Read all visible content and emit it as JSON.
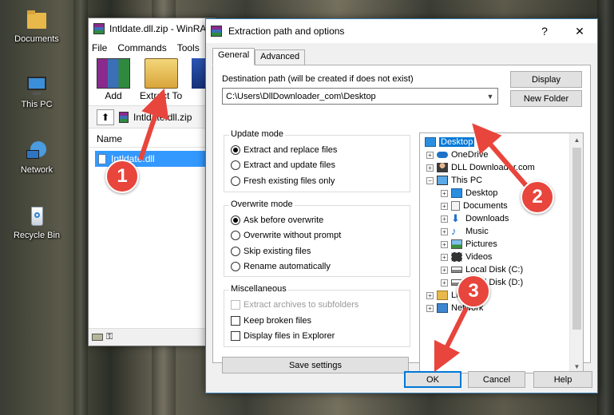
{
  "desktop": {
    "icons": [
      {
        "label": "Documents",
        "icon": "folder-icon"
      },
      {
        "label": "This PC",
        "icon": "monitor-icon"
      },
      {
        "label": "Network",
        "icon": "network-icon"
      },
      {
        "label": "Recycle Bin",
        "icon": "recycle-bin-icon"
      }
    ]
  },
  "winrar": {
    "title": "Intldate.dll.zip - WinRAR",
    "menu": [
      "File",
      "Commands",
      "Tools"
    ],
    "toolbar": {
      "add": "Add",
      "extract_to": "Extract To"
    },
    "path": "Intldate.dll.zip",
    "column_name": "Name",
    "file": "Intldate.dll"
  },
  "dialog": {
    "title": "Extraction path and options",
    "help_glyph": "?",
    "close_glyph": "✕",
    "tabs": [
      "General",
      "Advanced"
    ],
    "dest_label": "Destination path (will be created if does not exist)",
    "dest_value": "C:\\Users\\DllDownloader_com\\Desktop",
    "btn_display": "Display",
    "btn_new_folder": "New Folder",
    "update_mode": {
      "title": "Update mode",
      "options": [
        "Extract and replace files",
        "Extract and update files",
        "Fresh existing files only"
      ],
      "selected": 0
    },
    "overwrite_mode": {
      "title": "Overwrite mode",
      "options": [
        "Ask before overwrite",
        "Overwrite without prompt",
        "Skip existing files",
        "Rename automatically"
      ],
      "selected": 0
    },
    "misc": {
      "title": "Miscellaneous",
      "options": [
        "Extract archives to subfolders",
        "Keep broken files",
        "Display files in Explorer"
      ]
    },
    "btn_save": "Save settings",
    "tree": [
      "Desktop",
      "OneDrive",
      "DLL Downloader.com",
      "This PC",
      "Desktop",
      "Documents",
      "Downloads",
      "Music",
      "Pictures",
      "Videos",
      "Local Disk (C:)",
      "Local Disk (D:)",
      "Libraries",
      "Network"
    ],
    "btn_ok": "OK",
    "btn_cancel": "Cancel",
    "btn_help": "Help"
  },
  "annotations": [
    "1",
    "2",
    "3"
  ],
  "colors": {
    "accent": "#0078d7",
    "annotation": "#e8453c",
    "selection": "#3399ff"
  }
}
